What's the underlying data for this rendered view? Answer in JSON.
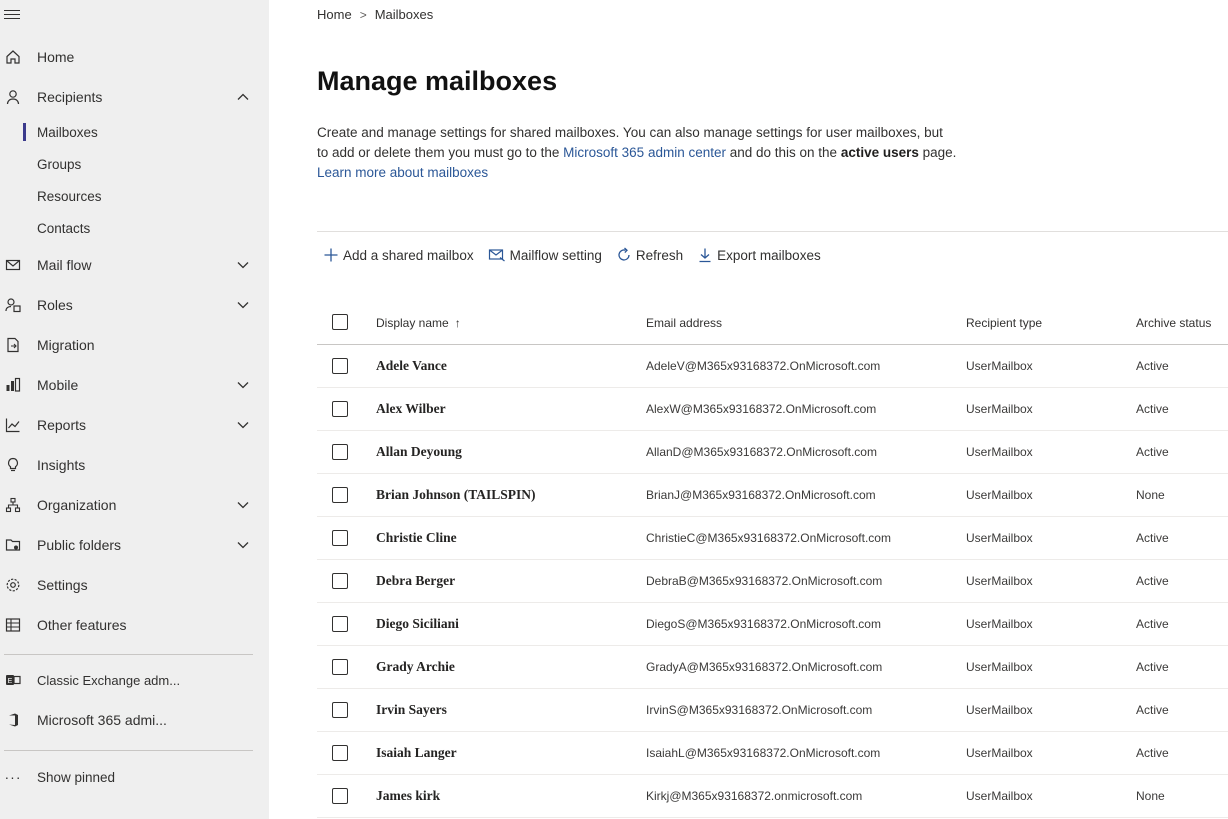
{
  "sidebar": {
    "items": [
      {
        "label": "Home",
        "icon": "home-icon"
      },
      {
        "label": "Recipients",
        "icon": "person-icon",
        "expanded": true
      },
      {
        "label": "Mail flow",
        "icon": "mail-icon"
      },
      {
        "label": "Roles",
        "icon": "roles-icon"
      },
      {
        "label": "Migration",
        "icon": "migration-icon"
      },
      {
        "label": "Mobile",
        "icon": "mobile-icon"
      },
      {
        "label": "Reports",
        "icon": "reports-icon"
      },
      {
        "label": "Insights",
        "icon": "lightbulb-icon"
      },
      {
        "label": "Organization",
        "icon": "organization-icon"
      },
      {
        "label": "Public folders",
        "icon": "public-folders-icon"
      },
      {
        "label": "Settings",
        "icon": "gear-icon"
      },
      {
        "label": "Other features",
        "icon": "table-icon"
      }
    ],
    "recipients_sub": [
      {
        "label": "Mailboxes",
        "selected": true
      },
      {
        "label": "Groups"
      },
      {
        "label": "Resources"
      },
      {
        "label": "Contacts"
      }
    ],
    "links": [
      {
        "label": "Classic Exchange adm...",
        "icon": "exchange-icon"
      },
      {
        "label": "Microsoft 365 admi...",
        "icon": "office-icon"
      }
    ],
    "show_pinned": "Show pinned"
  },
  "breadcrumb": {
    "home": "Home",
    "separator": ">",
    "current": "Mailboxes"
  },
  "page": {
    "title": "Manage mailboxes",
    "desc_part1": "Create and manage settings for shared mailboxes. You can also manage settings for user mailboxes, but to add or delete them you must go to the ",
    "desc_link1": "Microsoft 365 admin center",
    "desc_part2": " and do this on the ",
    "desc_bold": "active users",
    "desc_part3": " page. ",
    "desc_link2": "Learn more about mailboxes"
  },
  "toolbar": {
    "add": "Add a shared mailbox",
    "mailflow": "Mailflow setting",
    "refresh": "Refresh",
    "export": "Export mailboxes"
  },
  "table": {
    "columns": {
      "display_name": "Display name",
      "sort_indicator": "↑",
      "email": "Email address",
      "type": "Recipient type",
      "archive": "Archive status"
    },
    "rows": [
      {
        "name": "Adele Vance",
        "email": "AdeleV@M365x93168372.OnMicrosoft.com",
        "type": "UserMailbox",
        "archive": "Active"
      },
      {
        "name": "Alex Wilber",
        "email": "AlexW@M365x93168372.OnMicrosoft.com",
        "type": "UserMailbox",
        "archive": "Active"
      },
      {
        "name": "Allan Deyoung",
        "email": "AllanD@M365x93168372.OnMicrosoft.com",
        "type": "UserMailbox",
        "archive": "Active"
      },
      {
        "name": "Brian Johnson (TAILSPIN)",
        "email": "BrianJ@M365x93168372.OnMicrosoft.com",
        "type": "UserMailbox",
        "archive": "None"
      },
      {
        "name": "Christie Cline",
        "email": "ChristieC@M365x93168372.OnMicrosoft.com",
        "type": "UserMailbox",
        "archive": "Active"
      },
      {
        "name": "Debra Berger",
        "email": "DebraB@M365x93168372.OnMicrosoft.com",
        "type": "UserMailbox",
        "archive": "Active"
      },
      {
        "name": "Diego Siciliani",
        "email": "DiegoS@M365x93168372.OnMicrosoft.com",
        "type": "UserMailbox",
        "archive": "Active"
      },
      {
        "name": "Grady Archie",
        "email": "GradyA@M365x93168372.OnMicrosoft.com",
        "type": "UserMailbox",
        "archive": "Active"
      },
      {
        "name": "Irvin Sayers",
        "email": "IrvinS@M365x93168372.OnMicrosoft.com",
        "type": "UserMailbox",
        "archive": "Active"
      },
      {
        "name": "Isaiah Langer",
        "email": "IsaiahL@M365x93168372.OnMicrosoft.com",
        "type": "UserMailbox",
        "archive": "Active"
      },
      {
        "name": "James kirk",
        "email": "Kirkj@M365x93168372.onmicrosoft.com",
        "type": "UserMailbox",
        "archive": "None"
      }
    ]
  },
  "colors": {
    "sidebar_bg": "#efefef",
    "link": "#2b5797",
    "selected_bar": "#3b3a8c"
  }
}
